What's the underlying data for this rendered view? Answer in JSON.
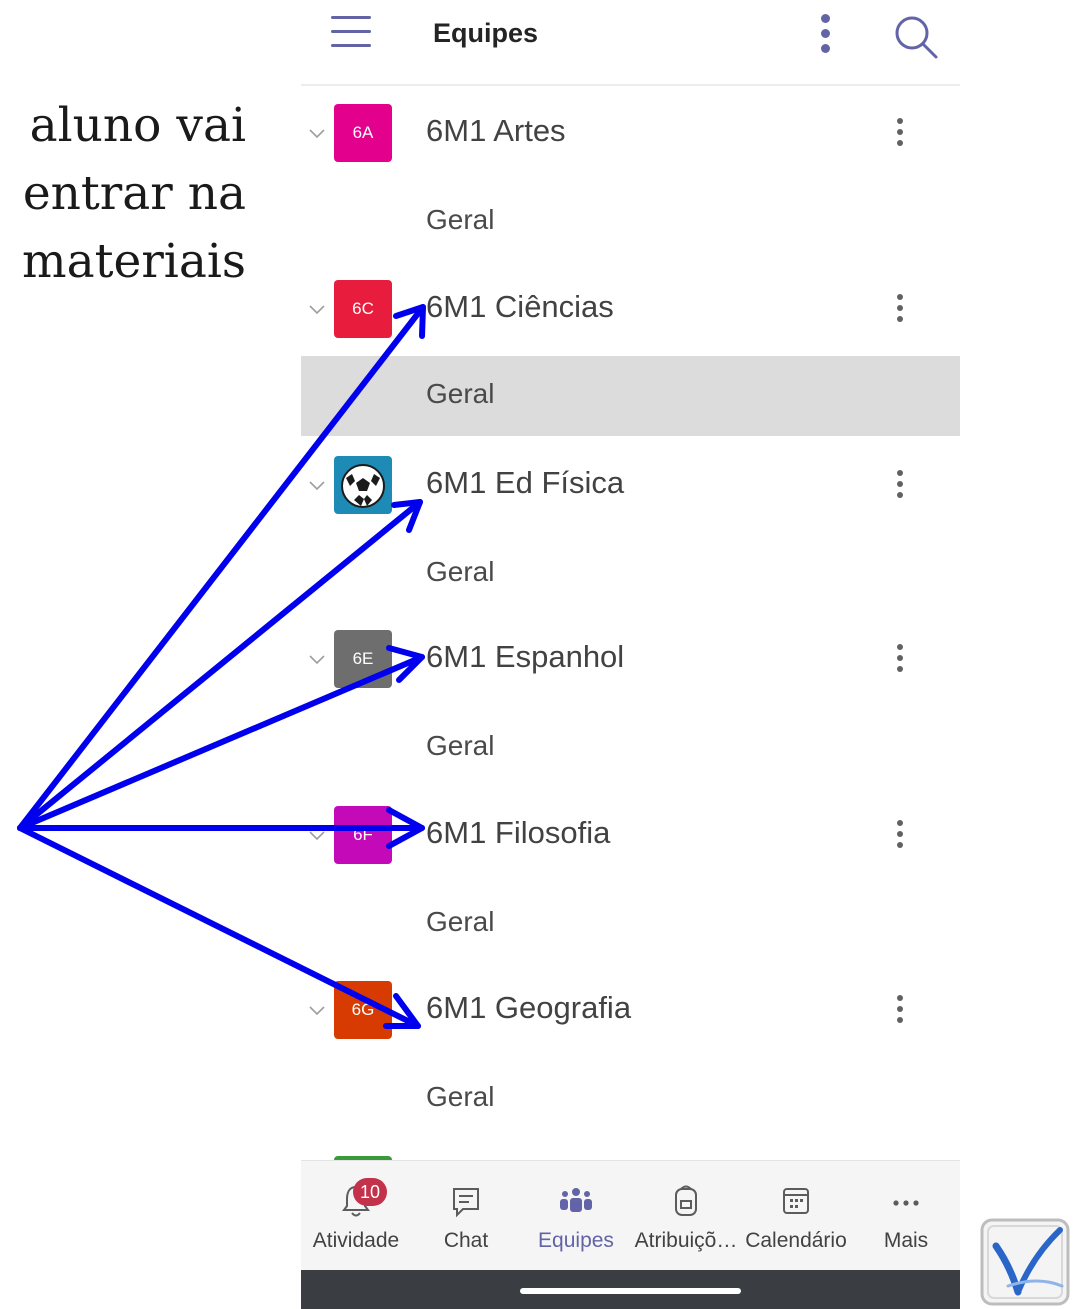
{
  "slide_text": {
    "line1": "aluno vai",
    "line2": "entrar na",
    "line3": "materiais"
  },
  "header": {
    "title": "Equipes"
  },
  "teams": [
    {
      "initials": "6A",
      "name": "6M1 Artes",
      "color": "#e3008c",
      "channel": "Geral"
    },
    {
      "initials": "6C",
      "name": "6M1 Ciências",
      "color": "#e81c3c",
      "channel": "Geral"
    },
    {
      "initials": "",
      "name": "6M1 Ed Física",
      "color": "#1e8bb6",
      "channel": "Geral"
    },
    {
      "initials": "6E",
      "name": "6M1 Espanhol",
      "color": "#6e6e6e",
      "channel": "Geral"
    },
    {
      "initials": "6F",
      "name": "6M1 Filosofia",
      "color": "#c40ab8",
      "channel": "Geral"
    },
    {
      "initials": "6G",
      "name": "6M1 Geografia",
      "color": "#d83b01",
      "channel": "Geral"
    }
  ],
  "bottom_nav": {
    "activity_label": "Atividade",
    "activity_badge": "10",
    "chat_label": "Chat",
    "teams_label": "Equipes",
    "assignments_label": "Atribuiçõ…",
    "calendar_label": "Calendário",
    "more_label": "Mais"
  },
  "colors": {
    "accent": "#6264a7",
    "arrow": "#0000ee",
    "selected_row": "#dcdcdc",
    "badge": "#c4314b"
  }
}
